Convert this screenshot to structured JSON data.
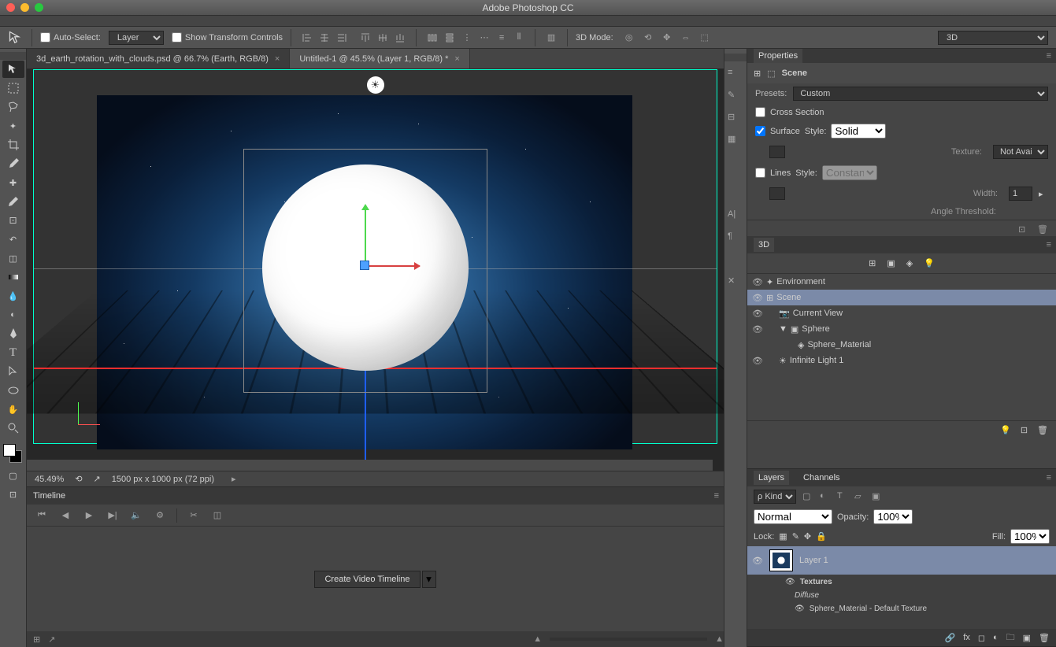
{
  "app_title": "Adobe Photoshop CC",
  "optbar": {
    "auto_select": "Auto-Select:",
    "auto_select_value": "Layer",
    "show_transform": "Show Transform Controls",
    "mode_3d": "3D Mode:",
    "right_dd": "3D"
  },
  "tabs": [
    {
      "label": "3d_earth_rotation_with_clouds.psd @ 66.7% (Earth, RGB/8)",
      "active": false
    },
    {
      "label": "Untitled-1 @ 45.5% (Layer 1, RGB/8) *",
      "active": true
    }
  ],
  "status": {
    "zoom": "45.49%",
    "docinfo": "1500 px x 1000 px (72 ppi)"
  },
  "timeline": {
    "title": "Timeline",
    "button": "Create Video Timeline"
  },
  "properties": {
    "title": "Properties",
    "header": "Scene",
    "presets_lbl": "Presets:",
    "presets_val": "Custom",
    "cross_section": "Cross Section",
    "surface": "Surface",
    "style_lbl": "Style:",
    "style_val": "Solid",
    "texture_lbl": "Texture:",
    "texture_val": "Not Availa…",
    "lines": "Lines",
    "lines_style_lbl": "Style:",
    "lines_style_val": "Constant",
    "width_lbl": "Width:",
    "width_val": "1",
    "angle_lbl": "Angle Threshold:"
  },
  "panel3d": {
    "title": "3D",
    "items": [
      {
        "label": "Environment",
        "indent": 0,
        "icon": "env"
      },
      {
        "label": "Scene",
        "indent": 0,
        "icon": "scene",
        "selected": true
      },
      {
        "label": "Current View",
        "indent": 1,
        "icon": "camera"
      },
      {
        "label": "Sphere",
        "indent": 1,
        "icon": "mesh",
        "expand": true
      },
      {
        "label": "Sphere_Material",
        "indent": 2,
        "icon": "material"
      },
      {
        "label": "Infinite Light 1",
        "indent": 1,
        "icon": "light"
      }
    ]
  },
  "layers": {
    "tabs": [
      "Layers",
      "Channels"
    ],
    "kind": "Kind",
    "blend": "Normal",
    "opacity_lbl": "Opacity:",
    "opacity_val": "100%",
    "lock_lbl": "Lock:",
    "fill_lbl": "Fill:",
    "fill_val": "100%",
    "layer1": "Layer 1",
    "textures": "Textures",
    "diffuse": "Diffuse",
    "material_tex": "Sphere_Material - Default Texture"
  }
}
